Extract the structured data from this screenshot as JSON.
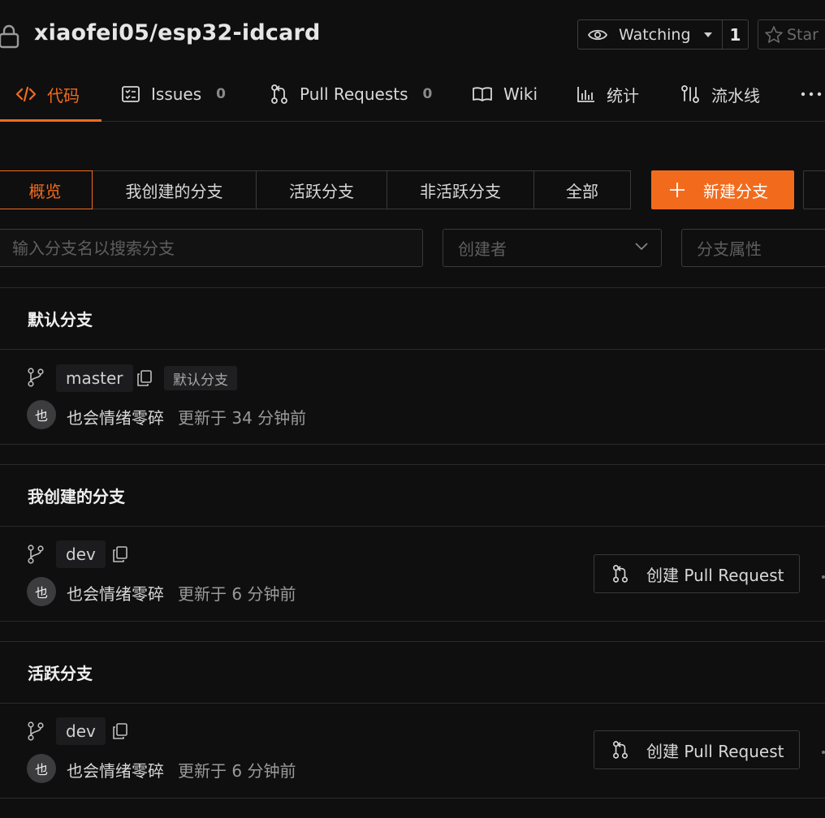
{
  "header": {
    "repo_title": "xiaofei05/esp32-idcard",
    "watch_label": "Watching",
    "watch_count": "1",
    "star_label": "Star"
  },
  "tabs": [
    {
      "label": "代码",
      "count": "",
      "icon": "code-icon",
      "active": true
    },
    {
      "label": "Issues",
      "count": "0",
      "icon": "issues-icon"
    },
    {
      "label": "Pull Requests",
      "count": "0",
      "icon": "pull-request-icon"
    },
    {
      "label": "Wiki",
      "count": "",
      "icon": "book-icon"
    },
    {
      "label": "统计",
      "count": "",
      "icon": "bar-chart-icon"
    },
    {
      "label": "流水线",
      "count": "",
      "icon": "pipeline-icon"
    }
  ],
  "filters": {
    "items": [
      "概览",
      "我创建的分支",
      "活跃分支",
      "非活跃分支",
      "全部"
    ],
    "active": "概览",
    "new_branch_label": "新建分支"
  },
  "search": {
    "placeholder": "输入分支名以搜索分支",
    "creator_placeholder": "创建者",
    "attr_placeholder": "分支属性"
  },
  "sections": [
    {
      "title": "默认分支",
      "branch": {
        "name": "master",
        "badge": "默认分支",
        "avatar": "也",
        "author": "也会情绪零碎",
        "updated": "更新于 34 分钟前",
        "pr_label": ""
      }
    },
    {
      "title": "我创建的分支",
      "branch": {
        "name": "dev",
        "badge": "",
        "avatar": "也",
        "author": "也会情绪零碎",
        "updated": "更新于 6 分钟前",
        "pr_label": "创建 Pull Request"
      }
    },
    {
      "title": "活跃分支",
      "branch": {
        "name": "dev",
        "badge": "",
        "avatar": "也",
        "author": "也会情绪零碎",
        "updated": "更新于 6 分钟前",
        "pr_label": "创建 Pull Request"
      }
    }
  ],
  "colors": {
    "accent": "#f26b1d",
    "background": "#0f0f10",
    "border": "#3a3a3c"
  }
}
